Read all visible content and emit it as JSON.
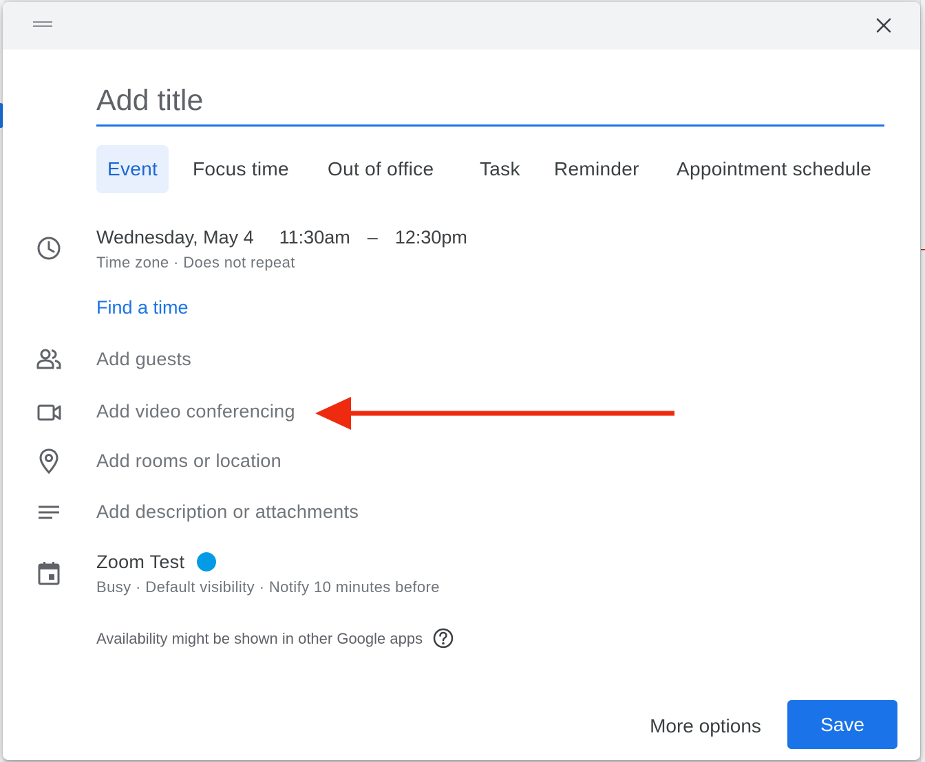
{
  "dialog": {
    "title_placeholder": "Add title",
    "tabs": [
      {
        "label": "Event",
        "active": true
      },
      {
        "label": "Focus time"
      },
      {
        "label": "Out of office"
      },
      {
        "label": "Task"
      },
      {
        "label": "Reminder"
      },
      {
        "label": "Appointment schedule"
      }
    ],
    "datetime": {
      "date": "Wednesday, May 4",
      "start": "11:30am",
      "separator": "–",
      "end": "12:30pm",
      "timezone": "Time zone",
      "dot": "·",
      "repeat": "Does not repeat"
    },
    "find_a_time": "Find a time",
    "guests_placeholder": "Add guests",
    "video_placeholder": "Add video conferencing",
    "location_placeholder": "Add rooms or location",
    "description_placeholder": "Add description or attachments",
    "calendar": {
      "name": "Zoom Test",
      "color": "#039be5",
      "status": "Busy",
      "visibility": "Default visibility",
      "notify": "Notify 10 minutes before"
    },
    "availability_note": "Availability might be shown in other Google apps",
    "more_options_label": "More options",
    "save_label": "Save"
  },
  "annotation": {
    "arrow_color": "#ee2a0f"
  },
  "colors": {
    "accent": "#1a73e8",
    "active_tab_bg": "#e8f0fe",
    "text": "#3c4043",
    "muted": "#70757a"
  },
  "icons": [
    "drag-handle-icon",
    "close-icon",
    "clock-icon",
    "people-icon",
    "videocam-icon",
    "location-pin-icon",
    "notes-icon",
    "calendar-icon",
    "help-circle-icon"
  ]
}
